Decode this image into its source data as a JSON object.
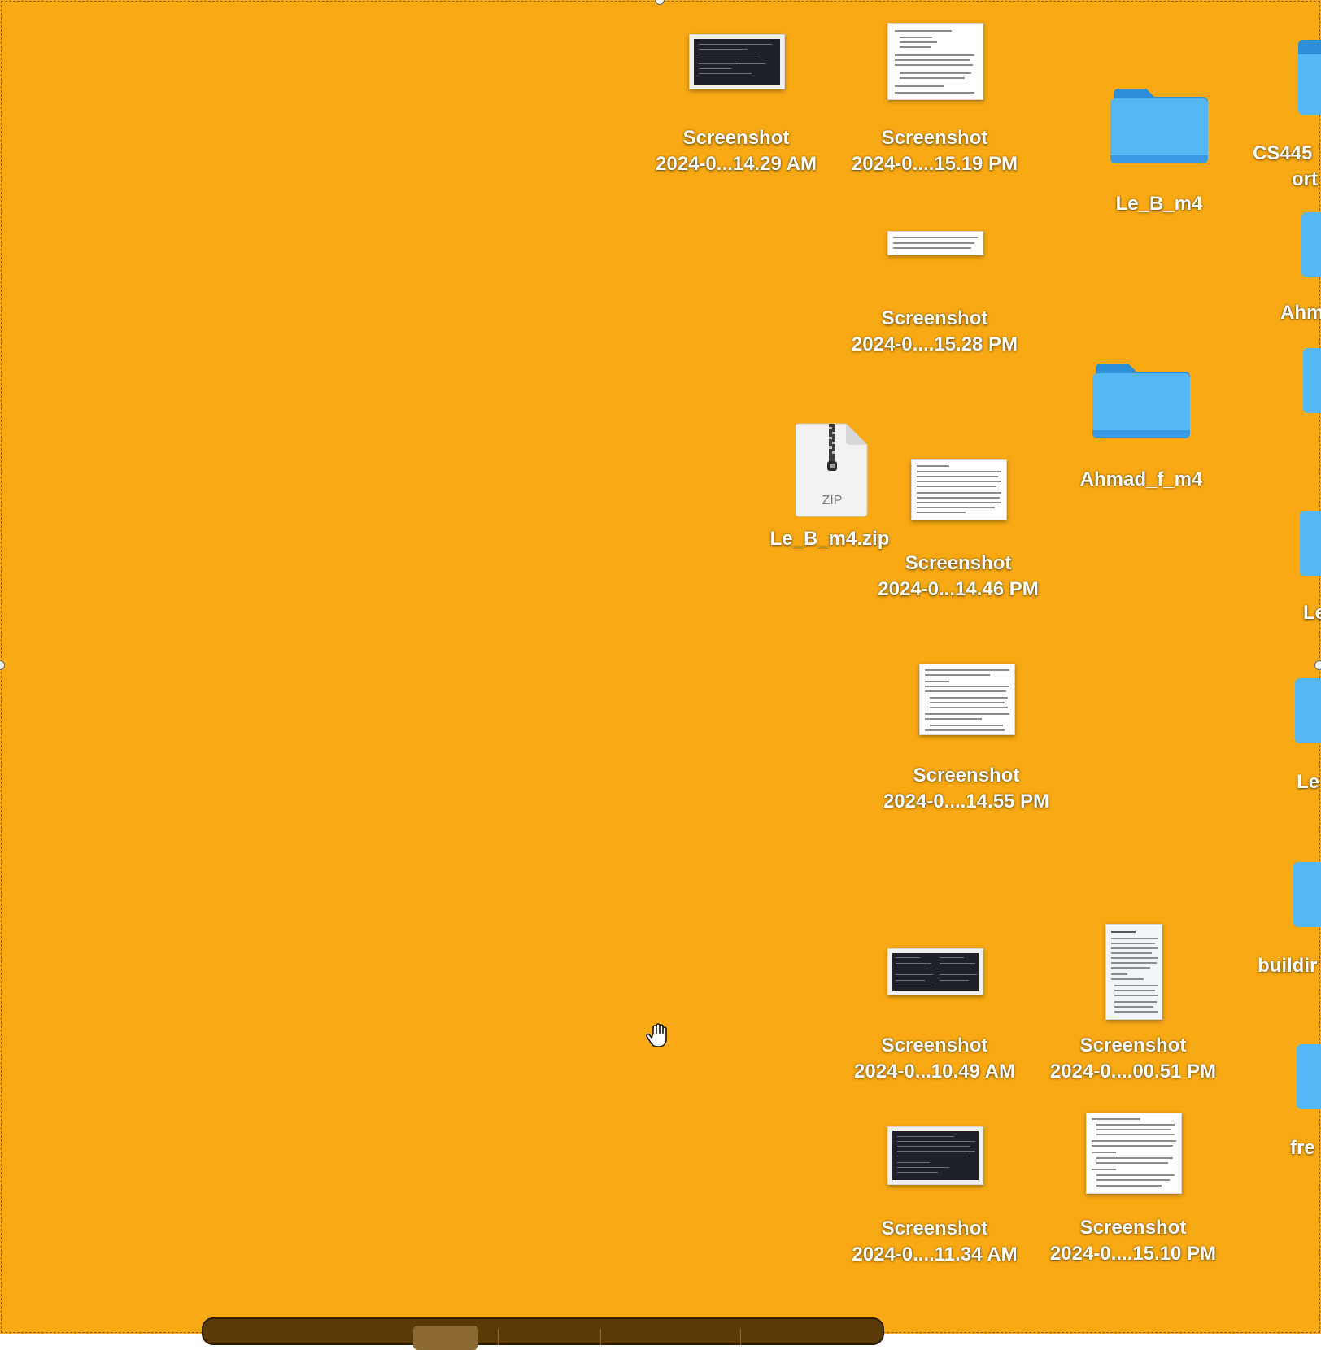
{
  "desktop": {
    "background_color": "#F8A913",
    "icons": [
      {
        "name": "Screenshot",
        "sub": "2024-0...14.29 AM",
        "kind": "screenshot-dark"
      },
      {
        "name": "Screenshot",
        "sub": "2024-0....15.19 PM",
        "kind": "screenshot-doc"
      },
      {
        "name": "Le_B_m4",
        "kind": "folder"
      },
      {
        "name": "Screenshot",
        "sub": "2024-0....15.28 PM",
        "kind": "screenshot-doc"
      },
      {
        "name": "Ahmad_f_m4",
        "kind": "folder"
      },
      {
        "name": "Le_B_m4.zip",
        "kind": "zip",
        "badge": "ZIP"
      },
      {
        "name": "Screenshot",
        "sub": "2024-0...14.46 PM",
        "kind": "screenshot-doc"
      },
      {
        "name": "Screenshot",
        "sub": "2024-0....14.55 PM",
        "kind": "screenshot-doc"
      },
      {
        "name": "Screenshot",
        "sub": "2024-0...10.49 AM",
        "kind": "screenshot-dark"
      },
      {
        "name": "Screenshot",
        "sub": "2024-0....00.51 PM",
        "kind": "screenshot-doc"
      },
      {
        "name": "Screenshot",
        "sub": "2024-0....11.34 AM",
        "kind": "screenshot-dark"
      },
      {
        "name": "Screenshot",
        "sub": "2024-0....15.10 PM",
        "kind": "screenshot-doc"
      }
    ],
    "edge_items": [
      {
        "line1": "CS445",
        "line2": "ort"
      },
      {
        "line1": "Ahm"
      },
      {
        "line1": "Le"
      },
      {
        "line1": "Le"
      },
      {
        "line1": "buildir"
      },
      {
        "line1": "fre"
      }
    ]
  }
}
